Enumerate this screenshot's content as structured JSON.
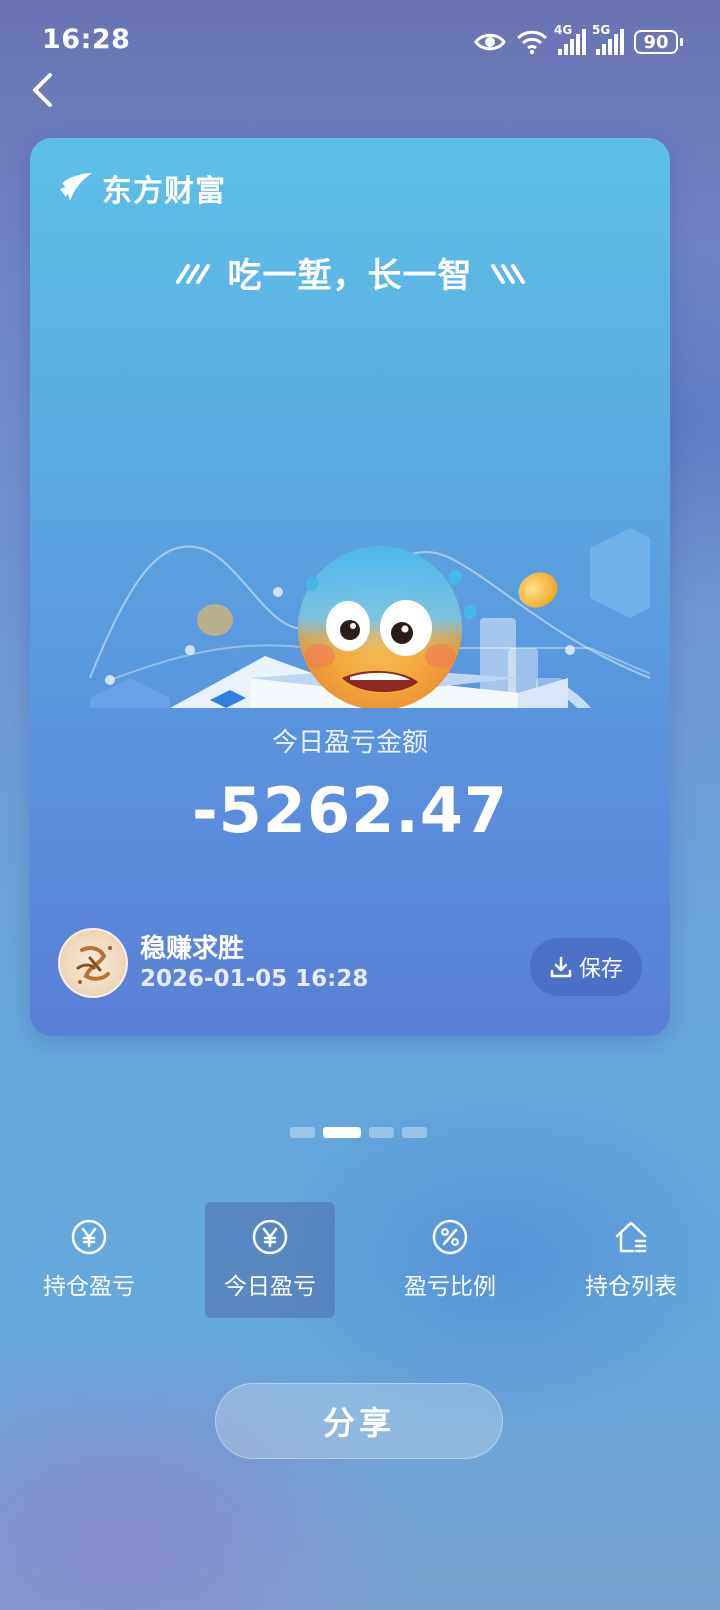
{
  "status_bar": {
    "time": "16:28",
    "network_1": "4G",
    "network_2": "5G",
    "battery": "90"
  },
  "card": {
    "brand": "东方财富",
    "slogan": "吃一堑，长一智",
    "pnl_label": "今日盈亏金额",
    "pnl_value": "-5262.47",
    "username": "稳赚求胜",
    "timestamp": "2026-01-05 16:28",
    "save_label": "保存"
  },
  "pager": {
    "count": 4,
    "active_index": 1
  },
  "tabs": [
    {
      "label": "持仓盈亏",
      "icon": "yen-circle-icon",
      "active": false
    },
    {
      "label": "今日盈亏",
      "icon": "yen-circle-icon",
      "active": true
    },
    {
      "label": "盈亏比例",
      "icon": "percent-circle-icon",
      "active": false
    },
    {
      "label": "持仓列表",
      "icon": "house-list-icon",
      "active": false
    }
  ],
  "share_label": "分享",
  "colors": {
    "card_top": "#5ec0e8",
    "card_bottom": "#5a7fd6",
    "emoji_face": "#f5b042",
    "box_stripe": "#2f7fe0"
  }
}
